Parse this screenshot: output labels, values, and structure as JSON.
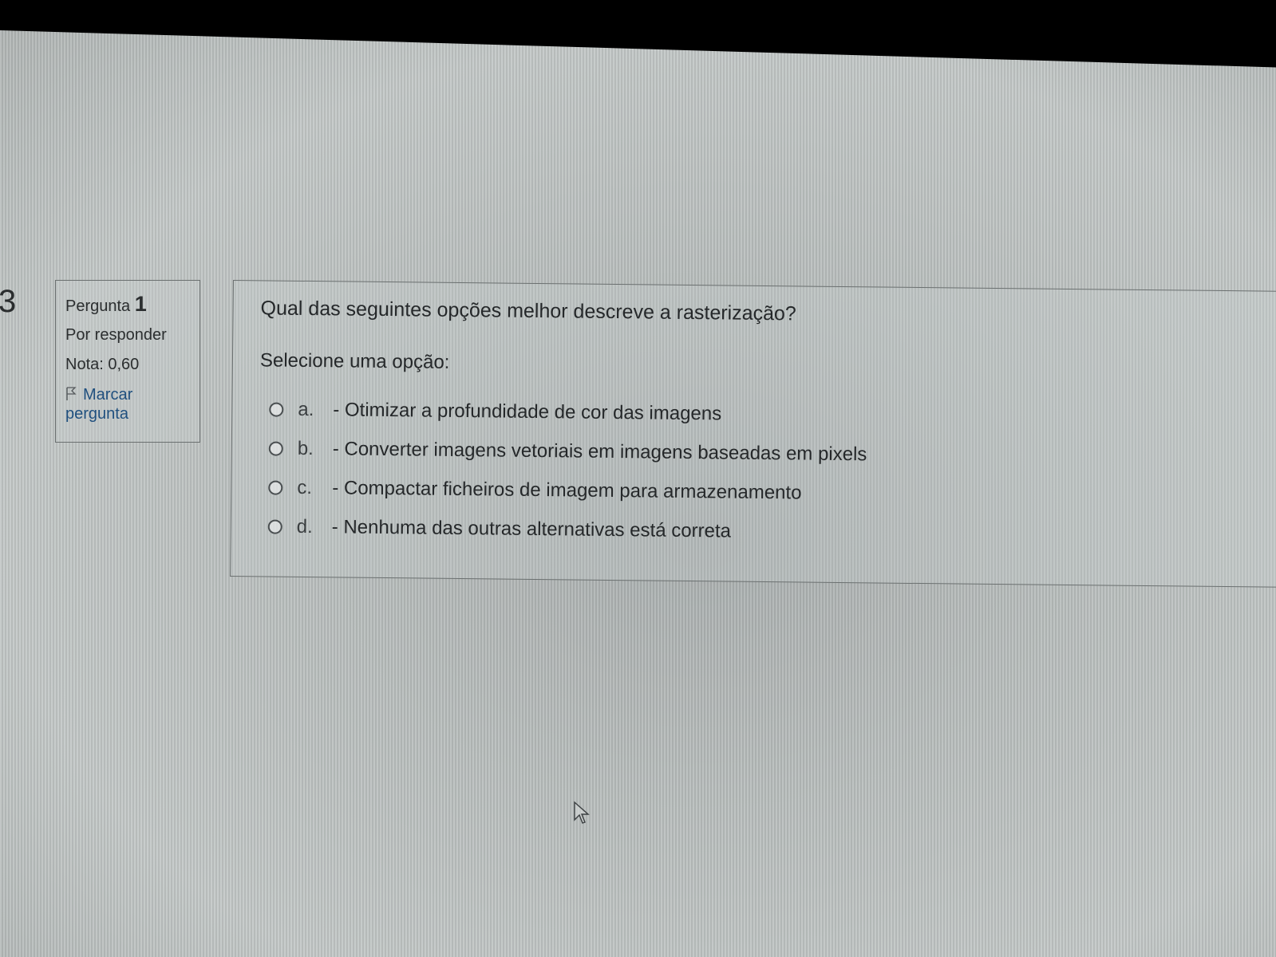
{
  "page_number": "3",
  "question_info": {
    "label": "Pergunta",
    "number": "1",
    "status": "Por responder",
    "grade": "Nota: 0,60",
    "flag_label": "Marcar pergunta"
  },
  "question": {
    "text": "Qual das seguintes opções melhor descreve a rasterização?",
    "prompt": "Selecione uma opção:",
    "answers": [
      {
        "letter": "a.",
        "text": "- Otimizar a profundidade de cor das imagens"
      },
      {
        "letter": "b.",
        "text": "- Converter imagens vetoriais em imagens baseadas em pixels"
      },
      {
        "letter": "c.",
        "text": "- Compactar ficheiros de imagem para armazenamento"
      },
      {
        "letter": "d.",
        "text": "- Nenhuma das outras alternativas está correta"
      }
    ]
  },
  "colors": {
    "link": "#1f4f7e",
    "text": "#25282a",
    "border": "#6b7070"
  }
}
